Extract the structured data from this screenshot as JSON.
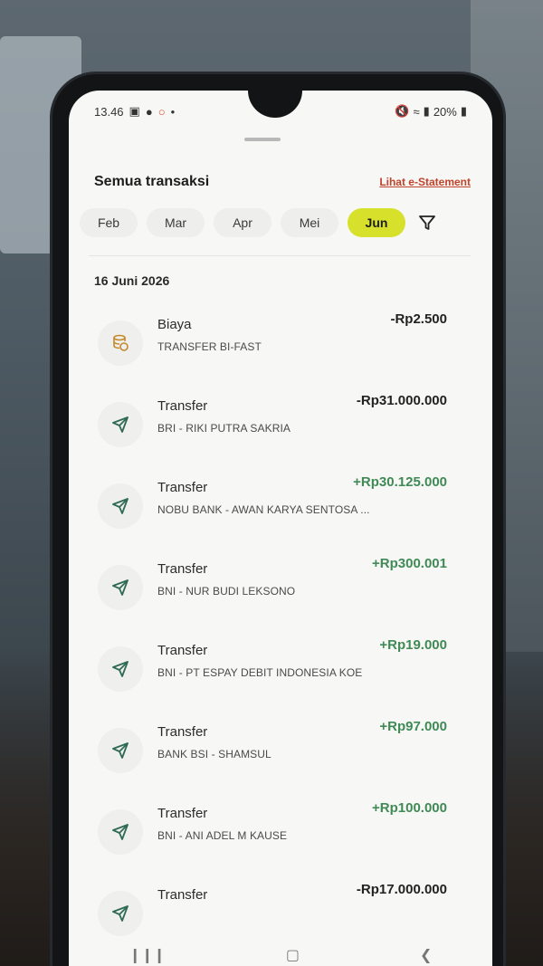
{
  "status_bar": {
    "time": "13.46",
    "battery": "20%"
  },
  "header": {
    "title": "Semua transaksi",
    "estatement_link": "Lihat e-Statement"
  },
  "months": [
    "Feb",
    "Mar",
    "Apr",
    "Mei",
    "Jun"
  ],
  "active_month": "Jun",
  "date_group": "16 Juni 2026",
  "transactions": [
    {
      "icon": "fee-coins-icon",
      "label": "Biaya",
      "desc": "TRANSFER BI-FAST",
      "amount": "-Rp2.500",
      "type": "neg"
    },
    {
      "icon": "send-icon",
      "label": "Transfer",
      "desc": "BRI - RIKI PUTRA SAKRIA",
      "amount": "-Rp31.000.000",
      "type": "neg"
    },
    {
      "icon": "send-icon",
      "label": "Transfer",
      "desc": "NOBU BANK - AWAN KARYA SENTOSA ...",
      "amount": "+Rp30.125.000",
      "type": "pos"
    },
    {
      "icon": "send-icon",
      "label": "Transfer",
      "desc": "BNI - NUR BUDI LEKSONO",
      "amount": "+Rp300.001",
      "type": "pos"
    },
    {
      "icon": "send-icon",
      "label": "Transfer",
      "desc": "BNI - PT ESPAY DEBIT INDONESIA KOE",
      "amount": "+Rp19.000",
      "type": "pos"
    },
    {
      "icon": "send-icon",
      "label": "Transfer",
      "desc": "BANK BSI - SHAMSUL",
      "amount": "+Rp97.000",
      "type": "pos"
    },
    {
      "icon": "send-icon",
      "label": "Transfer",
      "desc": "BNI - ANI ADEL M KAUSE",
      "amount": "+Rp100.000",
      "type": "pos"
    },
    {
      "icon": "send-icon",
      "label": "Transfer",
      "desc": "",
      "amount": "-Rp17.000.000",
      "type": "neg"
    }
  ],
  "colors": {
    "accent": "#d7e12b",
    "positive": "#3f8a55",
    "link": "#c0432b",
    "icon": "#2f6b52"
  }
}
